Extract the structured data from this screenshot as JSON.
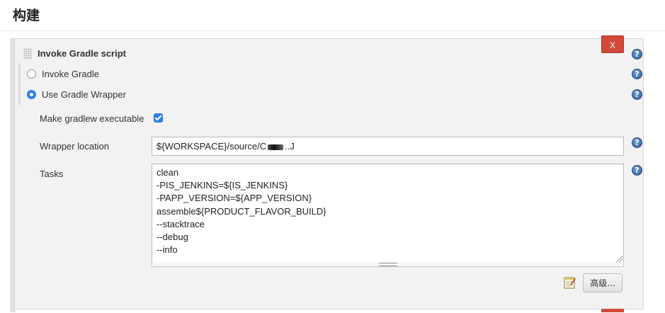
{
  "section": {
    "title": "构建"
  },
  "step": {
    "title": "Invoke Gradle script",
    "delete_label": "X",
    "help_symbol": "?",
    "options": [
      {
        "label": "Invoke Gradle",
        "selected": false
      },
      {
        "label": "Use Gradle Wrapper",
        "selected": true
      }
    ],
    "make_executable": {
      "label": "Make gradlew executable",
      "checked": true
    },
    "wrapper_location": {
      "label": "Wrapper location",
      "value_prefix": "${WORKSPACE}/source/C",
      "value_suffix": "..J"
    },
    "tasks": {
      "label": "Tasks",
      "lines": [
        "clean",
        "-PIS_JENKINS=${IS_JENKINS}",
        "-PAPP_VERSION=${APP_VERSION}",
        "assemble${PRODUCT_FLAVOR_BUILD}",
        "--stacktrace",
        "--debug",
        "--info"
      ]
    },
    "advanced_label": "高级..."
  },
  "colors": {
    "delete_button": "#d24939",
    "accent_blue": "#2d7ee6",
    "panel_bg": "#f2f2f2"
  },
  "icons": [
    "drag-handle-icon",
    "help-icon",
    "notepad-icon"
  ]
}
